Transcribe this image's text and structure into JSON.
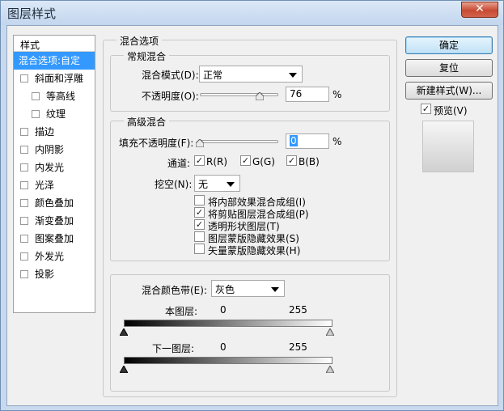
{
  "window": {
    "title": "图层样式",
    "close_glyph": "✕"
  },
  "style_list": {
    "header": "样式",
    "items": [
      {
        "label": "混合选项:自定",
        "selected": true,
        "has_checkbox": false,
        "sub": false
      },
      {
        "label": "斜面和浮雕",
        "has_checkbox": true,
        "checked": false,
        "sub": false
      },
      {
        "label": "等高线",
        "has_checkbox": true,
        "checked": false,
        "sub": true
      },
      {
        "label": "纹理",
        "has_checkbox": true,
        "checked": false,
        "sub": true
      },
      {
        "label": "描边",
        "has_checkbox": true,
        "checked": false,
        "sub": false
      },
      {
        "label": "内阴影",
        "has_checkbox": true,
        "checked": false,
        "sub": false
      },
      {
        "label": "内发光",
        "has_checkbox": true,
        "checked": false,
        "sub": false
      },
      {
        "label": "光泽",
        "has_checkbox": true,
        "checked": false,
        "sub": false
      },
      {
        "label": "颜色叠加",
        "has_checkbox": true,
        "checked": false,
        "sub": false
      },
      {
        "label": "渐变叠加",
        "has_checkbox": true,
        "checked": false,
        "sub": false
      },
      {
        "label": "图案叠加",
        "has_checkbox": true,
        "checked": false,
        "sub": false
      },
      {
        "label": "外发光",
        "has_checkbox": true,
        "checked": false,
        "sub": false
      },
      {
        "label": "投影",
        "has_checkbox": true,
        "checked": false,
        "sub": false
      }
    ]
  },
  "blend_options": {
    "title": "混合选项",
    "general": {
      "title": "常规混合",
      "mode_label": "混合模式(D):",
      "mode_value": "正常",
      "opacity_label": "不透明度(O):",
      "opacity_value": "76",
      "opacity_unit": "%",
      "opacity_fraction": 0.76
    },
    "advanced": {
      "title": "高级混合",
      "fill_label": "填充不透明度(F):",
      "fill_value": "0",
      "fill_unit": "%",
      "fill_fraction": 0.0,
      "channels_label": "通道:",
      "channels": [
        {
          "label": "R(R)",
          "checked": true
        },
        {
          "label": "G(G)",
          "checked": true
        },
        {
          "label": "B(B)",
          "checked": true
        }
      ],
      "knockout_label": "挖空(N):",
      "knockout_value": "无",
      "options": [
        {
          "label": "将内部效果混合成组(I)",
          "checked": false
        },
        {
          "label": "将剪贴图层混合成组(P)",
          "checked": true
        },
        {
          "label": "透明形状图层(T)",
          "checked": true
        },
        {
          "label": "图层蒙版隐藏效果(S)",
          "checked": false
        },
        {
          "label": "矢量蒙版隐藏效果(H)",
          "checked": false
        }
      ]
    },
    "blend_if": {
      "label": "混合颜色带(E):",
      "value": "灰色",
      "this_layer_label": "本图层:",
      "this_layer_min": "0",
      "this_layer_max": "255",
      "underlying_label": "下一图层:",
      "underlying_min": "0",
      "underlying_max": "255"
    }
  },
  "buttons": {
    "ok": "确定",
    "reset": "复位",
    "new_style": "新建样式(W)...",
    "preview_label": "预览(V)",
    "preview_checked": true
  },
  "colors": {
    "accent": "#3399ff",
    "title_bar": "#c8d9ee",
    "close": "#c74a33"
  }
}
